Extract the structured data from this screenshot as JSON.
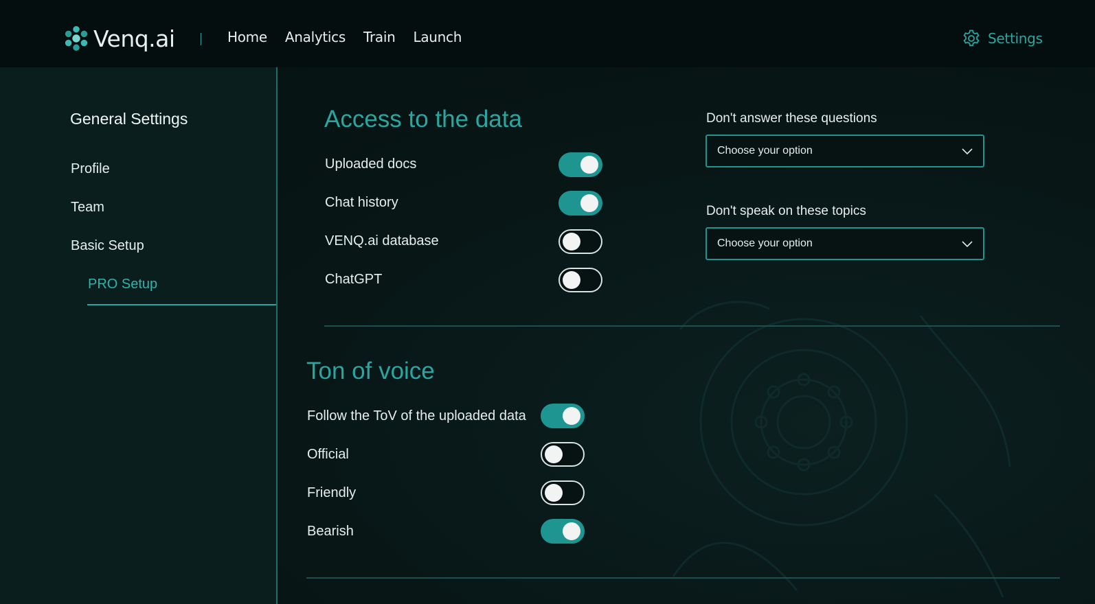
{
  "header": {
    "logo_text": "Venq.ai",
    "nav": [
      "Home",
      "Analytics",
      "Train",
      "Launch"
    ],
    "settings_label": "Settings"
  },
  "sidebar": {
    "title": "General Settings",
    "items": [
      {
        "label": "Profile",
        "active": false
      },
      {
        "label": "Team",
        "active": false
      },
      {
        "label": "Basic Setup",
        "active": false
      },
      {
        "label": "PRO Setup",
        "active": true
      }
    ]
  },
  "access": {
    "title": "Access to the data",
    "items": [
      {
        "label": "Uploaded docs",
        "on": true
      },
      {
        "label": "Chat history",
        "on": true
      },
      {
        "label": "VENQ.ai database",
        "on": false
      },
      {
        "label": "ChatGPT",
        "on": false
      }
    ]
  },
  "restrictions": {
    "questions_label": "Don't answer these questions",
    "questions_value": "Choose your option",
    "topics_label": "Don't speak on these topics",
    "topics_value": "Choose your option"
  },
  "voice": {
    "title": "Ton of voice",
    "items": [
      {
        "label": "Follow the ToV of the uploaded data",
        "on": true
      },
      {
        "label": "Official",
        "on": false
      },
      {
        "label": "Friendly",
        "on": false
      },
      {
        "label": "Bearish",
        "on": true
      }
    ]
  },
  "colors": {
    "accent": "#2aa6a0",
    "toggle_on": "#1e9590",
    "background": "#071414",
    "sidebar": "#0a1e1e"
  },
  "icons": {
    "logo": "swirl-logo-icon",
    "settings": "gear-icon",
    "dropdown": "chevron-down-icon"
  }
}
